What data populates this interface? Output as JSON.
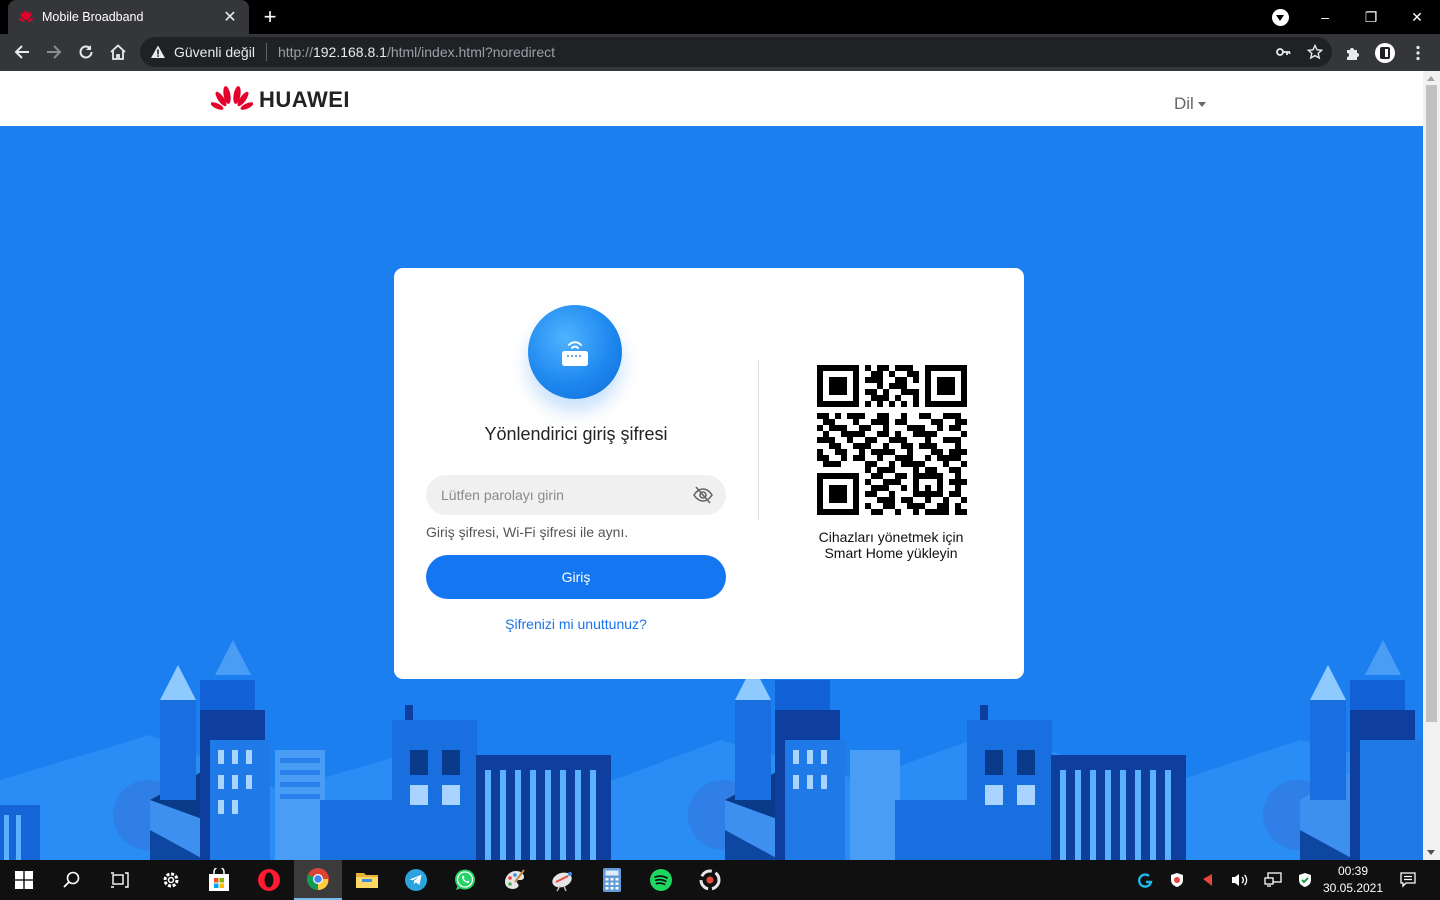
{
  "browser": {
    "tab_title": "Mobile Broadband",
    "tab_close": "✕",
    "new_tab": "+",
    "security_text": "Güvenli değil",
    "url_prefix": "http://",
    "url_host": "192.168.8.1",
    "url_path": "/html/index.html?noredirect",
    "window_controls": [
      "–",
      "❐",
      "✕"
    ]
  },
  "page": {
    "brand": "HUAWEI",
    "language_label": "Dil",
    "login": {
      "title": "Yönlendirici giriş şifresi",
      "password_placeholder": "Lütfen parolayı girin",
      "password_value": "",
      "hint": "Giriş şifresi, Wi-Fi şifresi ile aynı.",
      "login_button": "Giriş",
      "forgot_link": "Şifrenizi mi unuttunuz?"
    },
    "qr_caption_line1": "Cihazları yönetmek için",
    "qr_caption_line2": "Smart Home yükleyin"
  },
  "taskbar": {
    "icons": [
      "windows-start-icon",
      "search-icon",
      "task-view-icon",
      "settings-icon",
      "store-icon",
      "opera-icon",
      "chrome-icon",
      "file-explorer-icon",
      "telegram-icon",
      "whatsapp-icon",
      "paint-icon",
      "satellite-icon",
      "calculator-icon",
      "spotify-icon",
      "app-icon"
    ],
    "time": "00:39",
    "date": "30.05.2021"
  },
  "colors": {
    "page_blue": "#1b7ff0",
    "button_blue": "#1476f0",
    "link_blue": "#1a73e8",
    "huawei_red": "#e4002b"
  }
}
